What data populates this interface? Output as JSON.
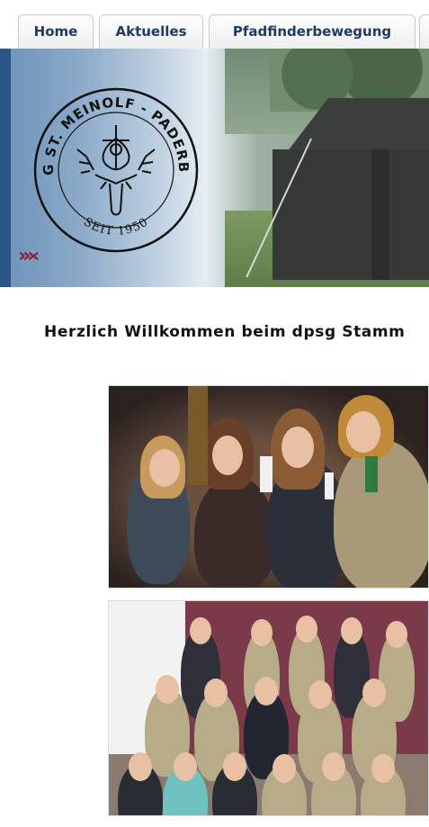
{
  "nav": {
    "tabs": [
      {
        "label": "Home"
      },
      {
        "label": "Aktuelles"
      },
      {
        "label": "Pfadfinderbewegung"
      }
    ]
  },
  "banner": {
    "logo_text_top": "DPSG ST. MEINOLF - PADERBORN",
    "logo_text_bottom": "SEIT 1950",
    "arrows": "›››‹"
  },
  "main": {
    "welcome_heading": "Herzlich Willkommen beim dpsg Stamm"
  },
  "colors": {
    "nav_text": "#1f3b63",
    "accent_red": "#8a1c2b",
    "banner_blue": "#2d5688"
  }
}
